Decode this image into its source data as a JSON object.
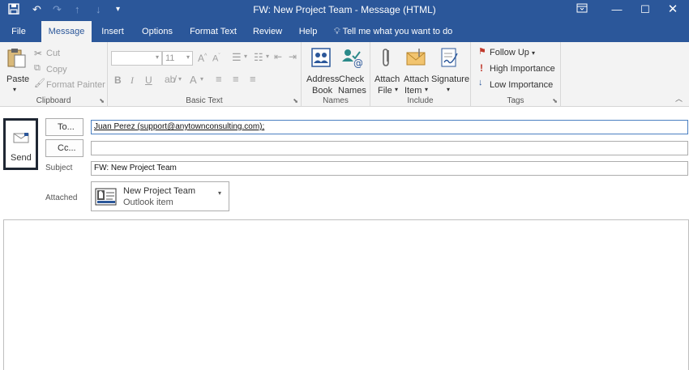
{
  "window": {
    "title": "FW: New Project Team  -  Message (HTML)",
    "qat_icons": [
      "save-icon",
      "undo-icon",
      "redo-icon",
      "up-arrow-icon",
      "down-arrow-icon",
      "customize-icon"
    ],
    "controls": [
      "ribbon-display-icon",
      "minimize-icon",
      "maximize-icon",
      "close-icon"
    ]
  },
  "tabs": {
    "file": "File",
    "message": "Message",
    "insert": "Insert",
    "options": "Options",
    "format_text": "Format Text",
    "review": "Review",
    "help": "Help",
    "tell_me": "Tell me what you want to do"
  },
  "ribbon": {
    "clipboard": {
      "label": "Clipboard",
      "paste": "Paste",
      "cut": "Cut",
      "copy": "Copy",
      "format_painter": "Format Painter"
    },
    "basic_text": {
      "label": "Basic Text",
      "font_size": "11"
    },
    "names": {
      "label": "Names",
      "address_book_1": "Address",
      "address_book_2": "Book",
      "check_names_1": "Check",
      "check_names_2": "Names"
    },
    "include": {
      "label": "Include",
      "attach_file_1": "Attach",
      "attach_file_2": "File",
      "attach_item_1": "Attach",
      "attach_item_2": "Item",
      "signature": "Signature"
    },
    "tags": {
      "label": "Tags",
      "follow_up": "Follow Up",
      "high_importance": "High Importance",
      "low_importance": "Low Importance"
    }
  },
  "compose": {
    "send": "Send",
    "to_button": "To...",
    "cc_button": "Cc...",
    "to_value": "Juan Perez (support@anytownconsulting.com);",
    "cc_value": "",
    "subject_label": "Subject",
    "subject_value": "FW: New Project Team",
    "attached_label": "Attached",
    "attachment_name": "New Project Team",
    "attachment_type": "Outlook item"
  },
  "colors": {
    "accent": "#2b579a",
    "ribbon_bg": "#f3f3f3",
    "flag": "#c0392b",
    "importance_high": "#c0392b",
    "importance_low": "#2b579a"
  }
}
